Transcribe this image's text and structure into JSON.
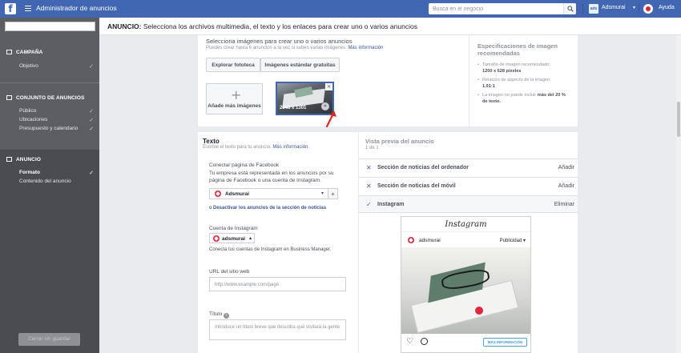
{
  "topbar": {
    "app_title": "Administrador de anuncios",
    "search_placeholder": "Busca en el negocio",
    "account_name": "Adsmurai",
    "account_logo": "adsmurai",
    "help_label": "Ayuda"
  },
  "sidebar": {
    "sections": [
      {
        "title": "CAMPAÑA",
        "items": [
          {
            "label": "Objetivo",
            "done": true
          }
        ]
      },
      {
        "title": "CONJUNTO DE ANUNCIOS",
        "items": [
          {
            "label": "Público",
            "done": true
          },
          {
            "label": "Ubicaciones",
            "done": true
          },
          {
            "label": "Presupuesto y calendario",
            "done": true
          }
        ]
      },
      {
        "title": "ANUNCIO",
        "items": [
          {
            "label": "Formato",
            "done": true
          },
          {
            "label": "Contenido del anuncio",
            "done": false
          }
        ]
      }
    ],
    "close_button": "Cerrar sin guardar"
  },
  "header": {
    "prefix": "ANUNCIO:",
    "text": "Selecciona los archivos multimedia, el texto y los enlaces para crear uno o varios anuncios"
  },
  "images": {
    "title": "Selecciona imágenes para crear uno o varios anuncios",
    "subtitle": "Puedes crear hasta 6 anuncios a la vez si subes varias imágenes.",
    "more_info": "Más información",
    "browse_button": "Explorar fototeca",
    "stock_button": "Imágenes estándar gratuitas",
    "add_more": "Añade más imágenes",
    "thumb_dims": "2048 x 1301"
  },
  "specs": {
    "title": "Especificaciones de imagen recomendadas",
    "items": [
      {
        "text": "Tamaño de imagen recomendado:",
        "value": "1200 x 628 píxeles"
      },
      {
        "text": "Relación de aspecto de la imagen:",
        "value": "1,91:1"
      },
      {
        "text": "La imagen no puede incluir",
        "value": "más del 20 % de texto."
      }
    ]
  },
  "text_panel": {
    "title": "Texto",
    "subtitle": "Escribe el texto para tu anuncio.",
    "more_info": "Más información.",
    "fb_label": "Conectar página de Facebook",
    "fb_desc": "Tu empresa está representada en los anuncios por su página de Facebook o una cuenta de Instagram.",
    "fb_page": "Adsmurai",
    "disconnect_prefix": "o",
    "disconnect_link": "Desactivar los anuncios de la sección de noticias",
    "ig_label": "Cuenta de Instagram",
    "ig_account": "adsmurai",
    "ig_desc": "Conecta tus cuentas de Instagram en Business Manager.",
    "url_label": "URL del sitio web",
    "url_placeholder": "http://www.example.com/page",
    "headline_label": "Título",
    "headline_placeholder": "Introduce un título breve que describa qué visitará la gente"
  },
  "preview": {
    "title": "Vista previa del anuncio",
    "count": "1 de 1",
    "rows": [
      {
        "name": "Sección de noticias del ordenador",
        "action": "Añadir",
        "mark": "x"
      },
      {
        "name": "Sección de noticias del móvil",
        "action": "Añadir",
        "mark": "x"
      },
      {
        "name": "Instagram",
        "action": "Eliminar",
        "mark": "check"
      }
    ],
    "ig": {
      "brand": "Instagram",
      "user": "adsmurai",
      "sponsored": "Publicidad",
      "cta": "MÁS INFORMACIÓN"
    }
  }
}
